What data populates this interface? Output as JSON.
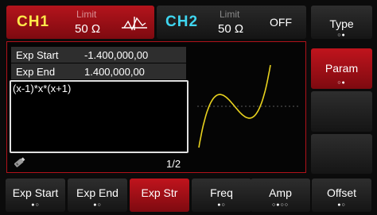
{
  "channel1": {
    "name": "CH1",
    "limit_label": "Limit",
    "impedance": "50 Ω",
    "waveform_icon": "arbitrary-wave-icon",
    "color": "#ffe94a",
    "active_bg": "#b4141c"
  },
  "channel2": {
    "name": "CH2",
    "limit_label": "Limit",
    "impedance": "50 Ω",
    "state": "OFF",
    "color": "#3fd6f0"
  },
  "params": {
    "exp_start": {
      "label": "Exp Start",
      "value": "-1.400,000,00"
    },
    "exp_end": {
      "label": "Exp End",
      "value": "1.400,000,00"
    }
  },
  "expression": "(x-1)*x*(x+1)",
  "page_indicator": "1/2",
  "storage_icon": "usb-drive-icon",
  "preview": {
    "curve_color": "#e8d21e",
    "baseline": "dotted"
  },
  "side_menu": [
    {
      "label": "Type",
      "dots": "○●",
      "active": false
    },
    {
      "label": "Param",
      "dots": "○●",
      "active": true
    },
    {
      "label": "",
      "dots": "",
      "active": false
    },
    {
      "label": "",
      "dots": "",
      "active": false
    }
  ],
  "bottom_menu": [
    {
      "label": "Exp Start",
      "dots": "●○",
      "active": false
    },
    {
      "label": "Exp End",
      "dots": "●○",
      "active": false
    },
    {
      "label": "Exp Str",
      "dots": "",
      "active": true
    },
    {
      "label": "Freq",
      "dots": "●○",
      "active": false
    },
    {
      "label": "Amp",
      "dots": "○●○○",
      "active": false
    },
    {
      "label": "Offset",
      "dots": "●○",
      "active": false
    }
  ]
}
